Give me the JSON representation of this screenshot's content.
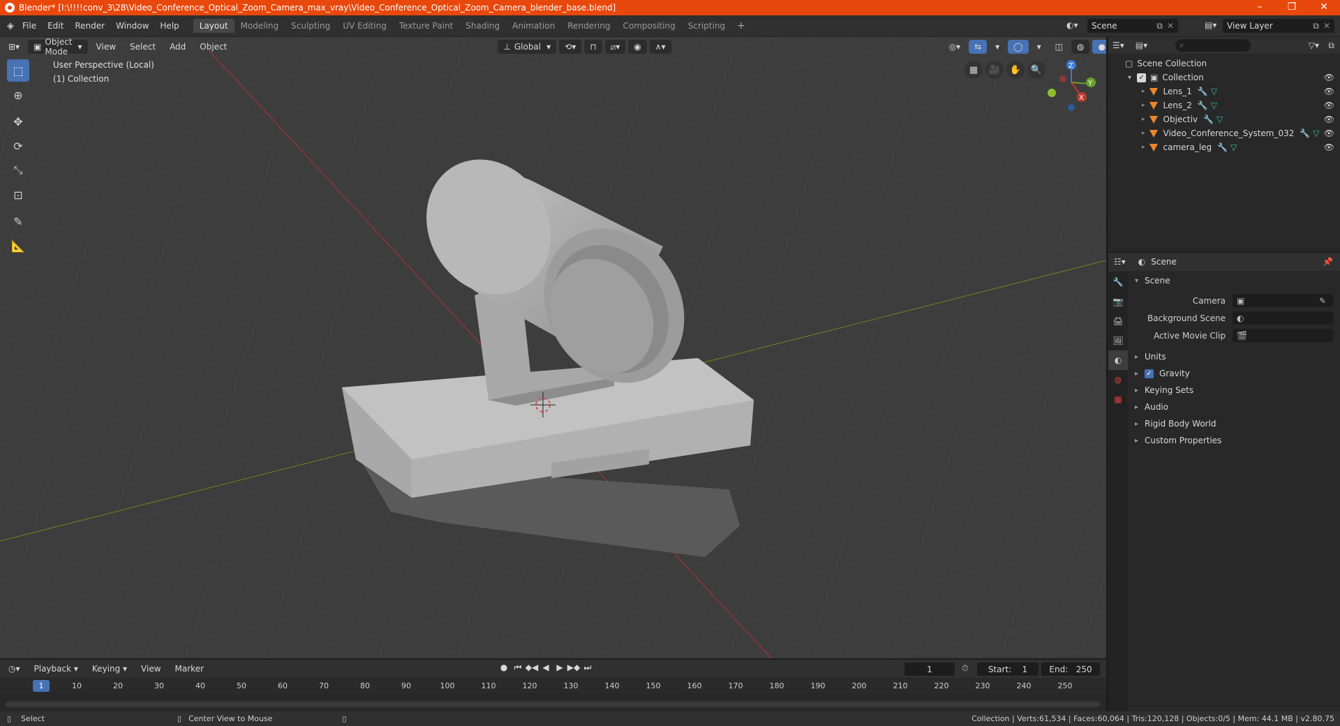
{
  "window": {
    "title": "Blender* [I:\\!!!!conv_3\\28\\Video_Conference_Optical_Zoom_Camera_max_vray\\Video_Conference_Optical_Zoom_Camera_blender_base.blend]",
    "minimize": "–",
    "maximize": "❐",
    "close": "✕"
  },
  "menu": [
    "File",
    "Edit",
    "Render",
    "Window",
    "Help"
  ],
  "workspaces": [
    "Layout",
    "Modeling",
    "Sculpting",
    "UV Editing",
    "Texture Paint",
    "Shading",
    "Animation",
    "Rendering",
    "Compositing",
    "Scripting"
  ],
  "active_workspace": "Layout",
  "scene_name": "Scene",
  "view_layer_name": "View Layer",
  "viewport": {
    "mode": "Object Mode",
    "menus": [
      "View",
      "Select",
      "Add",
      "Object"
    ],
    "transform_orientation": "Global",
    "perspective_label": "User Perspective (Local)",
    "collection_label": "(1) Collection",
    "gizmo": {
      "z": "Z",
      "y": "Y",
      "x": "X"
    }
  },
  "outliner": {
    "search_placeholder": "",
    "root": "Scene Collection",
    "collection": "Collection",
    "objects": [
      "Lens_1",
      "Lens_2",
      "Objectiv",
      "Video_Conference_System_032",
      "camera_leg"
    ]
  },
  "properties": {
    "header": "Scene",
    "section": "Scene",
    "fields": [
      {
        "label": "Camera",
        "value": ""
      },
      {
        "label": "Background Scene",
        "value": ""
      },
      {
        "label": "Active Movie Clip",
        "value": ""
      }
    ],
    "subsections": [
      "Units",
      "Gravity",
      "Keying Sets",
      "Audio",
      "Rigid Body World",
      "Custom Properties"
    ],
    "gravity_checked": true
  },
  "timeline": {
    "menus": [
      "Playback",
      "Keying",
      "View",
      "Marker"
    ],
    "current_frame": "1",
    "start_label": "Start:",
    "start": "1",
    "end_label": "End:",
    "end": "250",
    "ticks": [
      "10",
      "20",
      "30",
      "40",
      "50",
      "60",
      "70",
      "80",
      "90",
      "100",
      "110",
      "120",
      "130",
      "140",
      "150",
      "160",
      "170",
      "180",
      "190",
      "200",
      "210",
      "220",
      "230",
      "240",
      "250"
    ]
  },
  "status": {
    "left": "Select",
    "middle": "Center View to Mouse",
    "stats": "Collection | Verts:61,534 | Faces:60,064 | Tris:120,128 | Objects:0/5 | Mem: 44.1 MB | v2.80.75"
  },
  "colors": {
    "titlebar": "#e8480c",
    "accent": "#4772b3",
    "object_icon": "#e8882a",
    "x_axis": "#c0392b",
    "y_axis": "#6aa02a",
    "z_axis": "#3a7bd5"
  }
}
